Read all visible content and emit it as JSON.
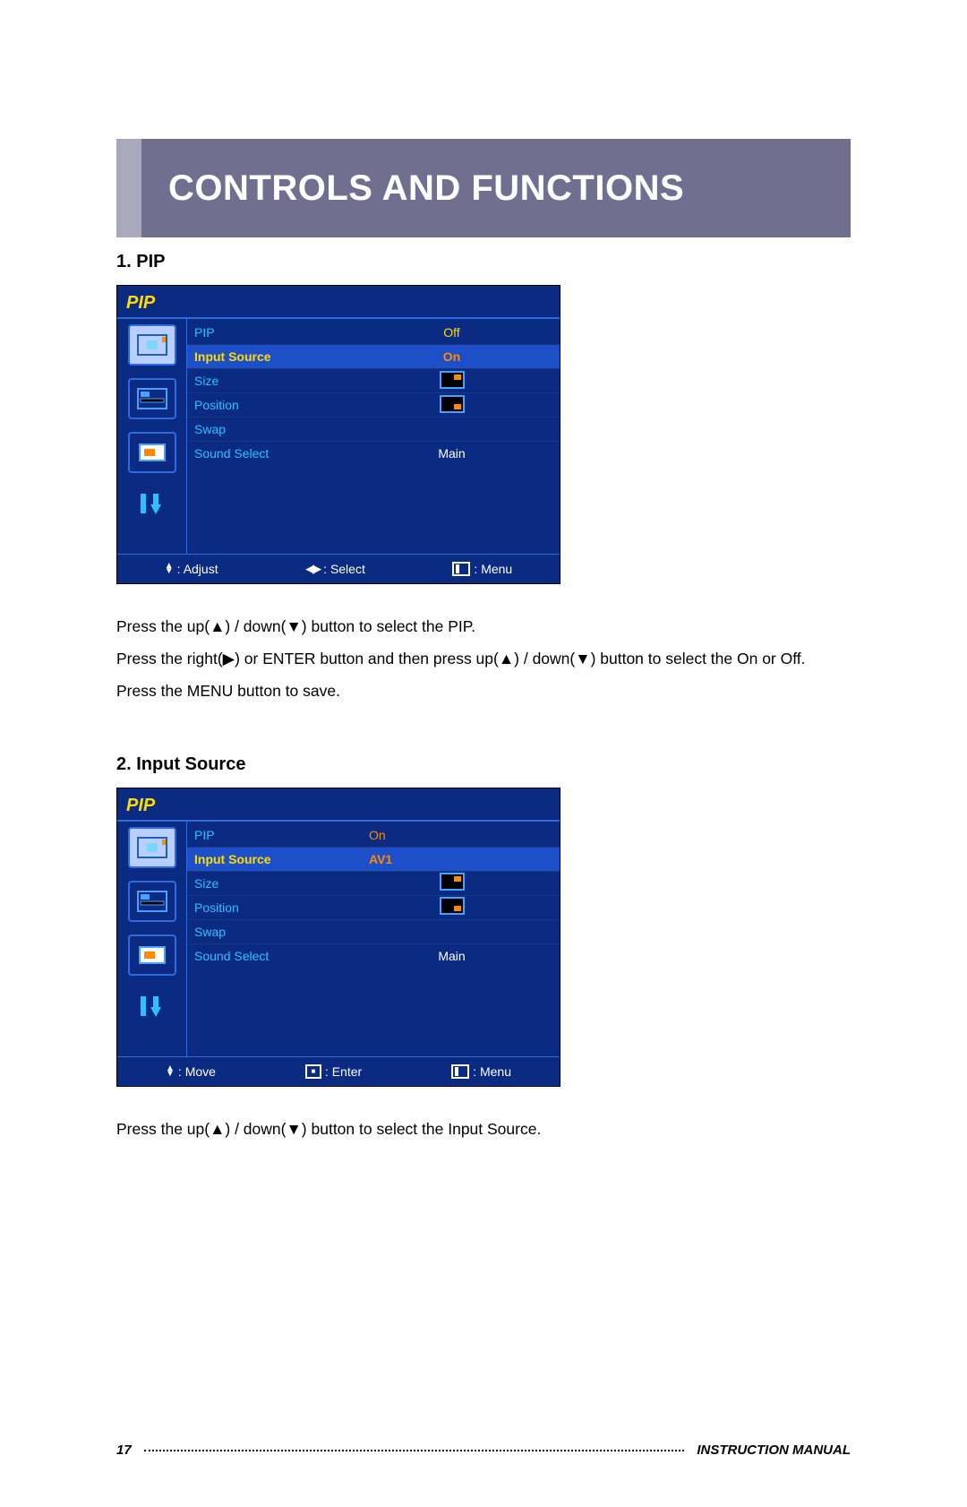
{
  "header": {
    "title": "CONTROLS AND FUNCTIONS"
  },
  "section1": {
    "heading": "1. PIP",
    "osd_title": "PIP",
    "rows": {
      "pip": {
        "label": "PIP",
        "value": "Off"
      },
      "input_source": {
        "label": "Input Source",
        "value": "On"
      },
      "size": {
        "label": "Size"
      },
      "position": {
        "label": "Position"
      },
      "swap": {
        "label": "Swap",
        "value": ""
      },
      "sound_select": {
        "label": "Sound Select",
        "value": "Main"
      }
    },
    "hints": {
      "a": "Adjust",
      "b": "Select",
      "c": "Menu"
    },
    "copy1": "Press the up(▲) / down(▼) button to select the PIP.",
    "copy2": "Press the right(▶) or ENTER button and then press up(▲) / down(▼) button to select the On or Off.",
    "copy3": "Press the MENU button to save."
  },
  "section2": {
    "heading": "2. Input Source",
    "osd_title": "PIP",
    "rows": {
      "pip": {
        "label": "PIP",
        "value": "On"
      },
      "input_source": {
        "label": "Input Source",
        "value": "AV1"
      },
      "size": {
        "label": "Size"
      },
      "position": {
        "label": "Position"
      },
      "swap": {
        "label": "Swap",
        "value": ""
      },
      "sound_select": {
        "label": "Sound Select",
        "value": "Main"
      }
    },
    "hints": {
      "a": "Move",
      "b": "Enter",
      "c": "Menu"
    },
    "copy1": "Press the up(▲) / down(▼) button to select the Input Source."
  },
  "footer": {
    "page": "17",
    "label": "INSTRUCTION MANUAL"
  }
}
